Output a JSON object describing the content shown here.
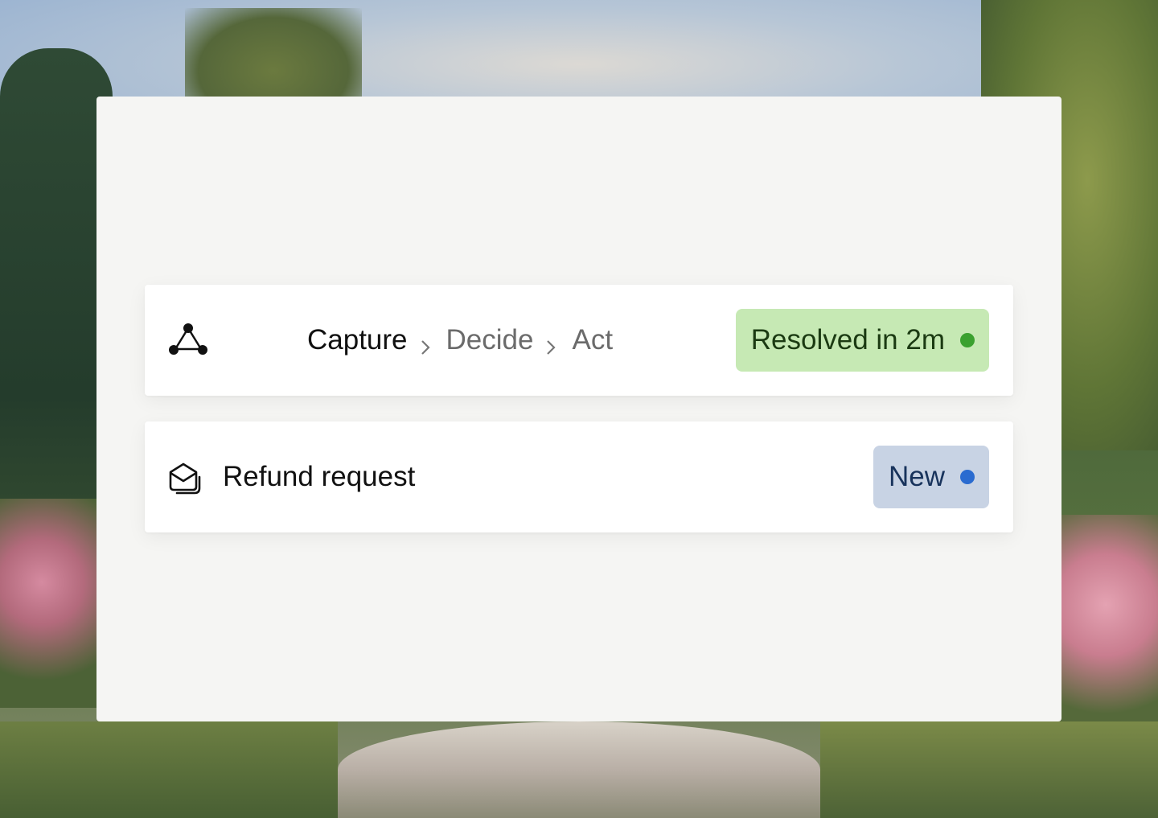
{
  "workflow": {
    "icon": "workflow-nodes-icon",
    "steps": [
      "Capture",
      "Decide",
      "Act"
    ],
    "status": {
      "label": "Resolved in 2m",
      "dot_color": "#3aa12f",
      "bg_color": "#c6e9b4"
    }
  },
  "ticket": {
    "icon": "mail-stack-icon",
    "title": "Refund request",
    "status": {
      "label": "New",
      "dot_color": "#2a6bd0",
      "bg_color": "#c8d3e4"
    }
  }
}
